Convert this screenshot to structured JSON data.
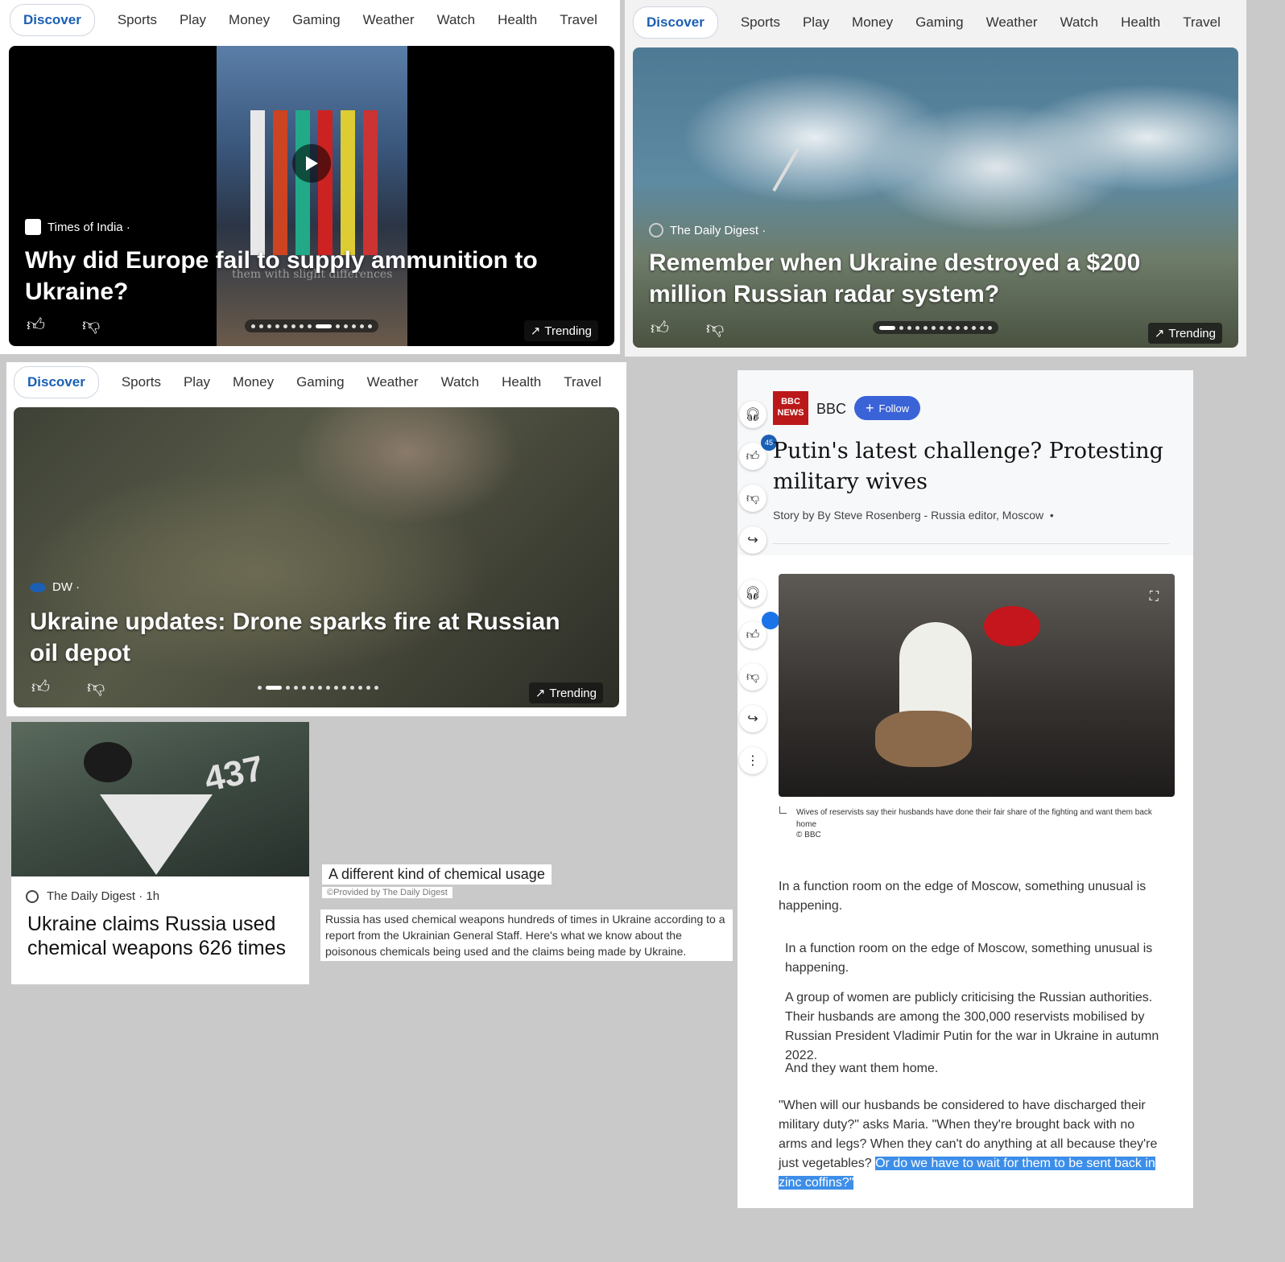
{
  "nav": {
    "discover": "Discover",
    "tabs": [
      "Sports",
      "Play",
      "Money",
      "Gaming",
      "Weather",
      "Watch",
      "Health",
      "Travel"
    ]
  },
  "cards": [
    {
      "source": "Times of India ·",
      "headline": "Why did Europe fail to supply ammunition to Ukraine?",
      "overlay": "them with slight differences",
      "trending": "Trending"
    },
    {
      "source": "The Daily Digest ·",
      "headline": "Remember when Ukraine destroyed a $200 million Russian radar system?",
      "trending": "Trending"
    },
    {
      "source": "DW ·",
      "headline": "Ukraine updates: Drone sparks fire at Russian oil depot",
      "trending": "Trending"
    }
  ],
  "small_card": {
    "number": "437",
    "source": "The Daily Digest · 1h",
    "headline": "Ukraine claims Russia used chemical weapons 626 times"
  },
  "excerpt": {
    "title": "A different kind of chemical usage",
    "provided": "©Provided by The Daily Digest",
    "text": "Russia has used chemical weapons hundreds of times in Ukraine according to a report from the Ukrainian General Staff. Here's what we know about the poisonous chemicals being used and the claims being made by Ukraine."
  },
  "article": {
    "publisher_logo": "BBC NEWS",
    "publisher": "BBC",
    "follow": "Follow",
    "like_count": "45",
    "title": "Putin's latest challenge? Protesting military wives",
    "byline": "Story by By Steve Rosenberg - Russia editor, Moscow  •",
    "caption": "Wives of reservists say their husbands have done their fair share of the fighting and want them back home",
    "credit": "© BBC",
    "p1": "In a function room on the edge of Moscow, something unusual is happening.",
    "p2": "In a function room on the edge of Moscow, something unusual is happening.",
    "p3": "A group of women are publicly criticising the Russian authorities. Their husbands are among the 300,000 reservists mobilised by Russian President Vladimir Putin for the war in Ukraine in autumn 2022.",
    "p4": "And they want them home.",
    "p5": "\"When will our husbands be considered to have discharged their military duty?\" asks Maria. \"When they're brought back with no arms and legs? When they can't do anything at all because they're just vegetables? ",
    "p5_highlight": "Or do we have to wait for them to be sent back in zinc coffins?\""
  },
  "colors": {
    "accent": "#1a5fb4",
    "follow": "#3b63d8",
    "highlight": "#3d8ee8",
    "bbc_red": "#bb1919"
  }
}
